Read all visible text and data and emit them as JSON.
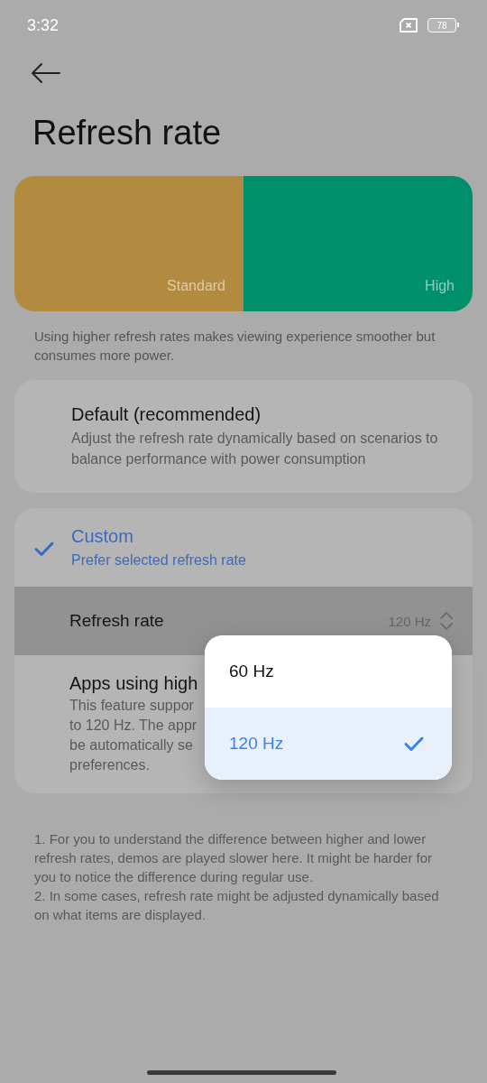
{
  "status_bar": {
    "time": "3:32",
    "battery": "78"
  },
  "header": {
    "title": "Refresh rate"
  },
  "demo": [
    {
      "label": "Standard",
      "color": "#b38b40"
    },
    {
      "label": "High",
      "color": "#008f6b"
    }
  ],
  "intro": "Using higher refresh rates makes viewing experience smoother but consumes more power.",
  "modes": [
    {
      "title": "Default (recommended)",
      "subtitle": "Adjust the refresh rate dynamically based on scenarios to balance performance with power consumption",
      "selected": false
    },
    {
      "title": "Custom",
      "subtitle": "Prefer selected refresh rate",
      "selected": true
    }
  ],
  "rate_row": {
    "label": "Refresh rate",
    "value": "120 Hz",
    "highlighted": true
  },
  "apps_item": {
    "title": "Apps using high",
    "lines": [
      "This feature suppor",
      "to 120 Hz. The appr",
      "be automatically se",
      "preferences."
    ]
  },
  "footnotes": [
    "1. For you to understand the difference between higher and lower refresh rates, demos are played slower here. It might be harder for you to notice the difference during regular use.",
    "2. In some cases, refresh rate might be adjusted dynamically based on what items are displayed."
  ],
  "dropdown": {
    "options": [
      {
        "label": "60 Hz",
        "selected": false
      },
      {
        "label": "120 Hz",
        "selected": true
      }
    ]
  }
}
